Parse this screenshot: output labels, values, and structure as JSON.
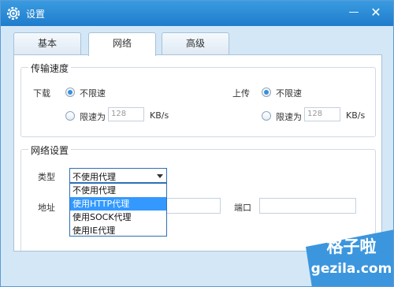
{
  "window": {
    "title": "设置",
    "minimize_glyph": "—",
    "close_glyph": "✕"
  },
  "tabs": [
    {
      "label": "基本",
      "active": false
    },
    {
      "label": "网络",
      "active": true
    },
    {
      "label": "高级",
      "active": false
    }
  ],
  "speed": {
    "title": "传输速度",
    "download": {
      "label": "下载",
      "unlimited": "不限速",
      "limit_label": "限速为",
      "limit_value": "128",
      "unit": "KB/s",
      "selected": "unlimited"
    },
    "upload": {
      "label": "上传",
      "unlimited": "不限速",
      "limit_label": "限速为",
      "limit_value": "128",
      "unit": "KB/s",
      "selected": "unlimited"
    }
  },
  "network": {
    "title": "网络设置",
    "type_label": "类型",
    "type_value": "不使用代理",
    "options": [
      "不使用代理",
      "使用HTTP代理",
      "使用SOCK代理",
      "使用IE代理"
    ],
    "highlighted_option": "使用HTTP代理",
    "address_label": "地址",
    "port_label": "端口",
    "address_value": "",
    "port_value": ""
  },
  "watermark": {
    "line1": "格子啦",
    "line2": "gezila.com"
  },
  "colors": {
    "titlebar": "#2a8cd8",
    "accent": "#3399ff",
    "window_bg": "#d4e7f6",
    "panel_bg": "#ffffff",
    "watermark": "#3b96de"
  },
  "icons": {
    "app": "gear-icon",
    "dropdown": "caret-down-icon"
  }
}
